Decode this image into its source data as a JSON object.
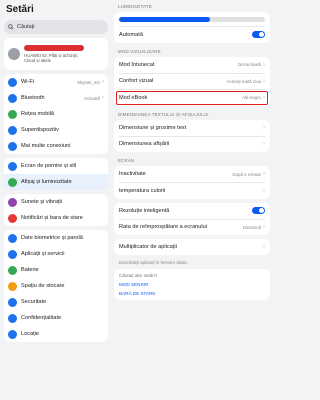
{
  "left": {
    "title": "Setări",
    "search_placeholder": "Căutați",
    "account": {
      "subtitle_line1": "HUAWEI ID, Plăți și achiziții,",
      "subtitle_line2": "Cloud și altele"
    },
    "group1": [
      {
        "label": "Wi-Fi",
        "value": "SkyNet_5G",
        "color": "#1a73e8",
        "icon": "wifi-icon"
      },
      {
        "label": "Bluetooth",
        "value": "Activată",
        "color": "#1a73e8",
        "icon": "bluetooth-icon"
      },
      {
        "label": "Rețea mobilă",
        "value": "",
        "color": "#34a853",
        "icon": "mobile-network-icon"
      },
      {
        "label": "Superdispozitiv",
        "value": "",
        "color": "#1a73e8",
        "icon": "super-device-icon"
      },
      {
        "label": "Mai multe conexiuni",
        "value": "",
        "color": "#1a73e8",
        "icon": "connections-icon"
      }
    ],
    "group2": [
      {
        "label": "Ecran de pornire și stil",
        "color": "#1a73e8",
        "icon": "home-screen-icon"
      },
      {
        "label": "Afișaj și luminozitate",
        "color": "#34a853",
        "icon": "display-icon"
      }
    ],
    "group3": [
      {
        "label": "Sunete și vibrații",
        "color": "#8e44ad",
        "icon": "sound-icon"
      },
      {
        "label": "Notificări și bara de stare",
        "color": "#e53935",
        "icon": "notifications-icon"
      }
    ],
    "group4": [
      {
        "label": "Date biometrice și parolă",
        "color": "#1a73e8",
        "icon": "biometrics-icon"
      },
      {
        "label": "Aplicații și servicii",
        "color": "#1a73e8",
        "icon": "apps-icon"
      },
      {
        "label": "Baterie",
        "color": "#34a853",
        "icon": "battery-icon"
      },
      {
        "label": "Spațiu de stocare",
        "color": "#f39c12",
        "icon": "storage-icon"
      },
      {
        "label": "Securitate",
        "color": "#1a73e8",
        "icon": "security-icon"
      },
      {
        "label": "Confidențialitate",
        "color": "#1a73e8",
        "icon": "privacy-icon"
      },
      {
        "label": "Locație",
        "color": "#1a73e8",
        "icon": "location-icon"
      }
    ]
  },
  "right": {
    "brightness_section": "LUMINOZITATE",
    "brightness_level": 0.62,
    "auto_label": "Automată",
    "visual_section": "MOD VIZUALIZARE",
    "dark_mode": {
      "label": "Mod întunecat",
      "value": "Dezactivată"
    },
    "visual_comfort": {
      "label": "Confort vizual",
      "value": "Activați toată ziua"
    },
    "ebook": {
      "label": "Mod eBook",
      "value": "Alb-negru"
    },
    "text_section": "DIMENSIUNEA TEXTULUI ȘI AFIȘAJULUI",
    "text_size": {
      "label": "Dimensiune și grosime text"
    },
    "display_size": {
      "label": "Dimensiunea afișării"
    },
    "screen_section": "ECRAN",
    "inactivity": {
      "label": "Inactivitate",
      "value": "După 2 minute"
    },
    "color_temp": {
      "label": "temperatura culorii"
    },
    "smart_resolution": {
      "label": "Rezoluție inteligentă"
    },
    "refresh_rate": {
      "label": "Rata de reîmprospătare a ecranului",
      "value": "Dinamică"
    },
    "multiplier": {
      "label": "Multiplicator de aplicații"
    },
    "multiplier_note": "Deschideți aplicații în ferestre duale.",
    "search_other": "Căutați alte setări?",
    "link1": "MOD SENIOR",
    "link2": "BARĂ DE STARE",
    "accent": "#0a59f7",
    "highlight": "#e02020"
  }
}
